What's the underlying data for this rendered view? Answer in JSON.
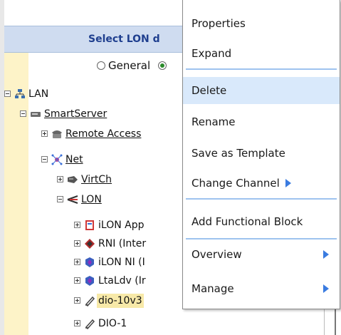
{
  "panel": {
    "header": "Select LON d",
    "radio_general": "General"
  },
  "tree": {
    "lan": "LAN",
    "smartserver": "SmartServer",
    "remote_access": "Remote Access",
    "net": "Net",
    "virtch": "VirtCh",
    "lon": "LON",
    "ilon_app": "iLON App",
    "rni": "RNI (Inter",
    "ilon_ni": "iLON NI (I",
    "ltaldv": "LtaLdv (Ir",
    "dio_10v3": "dio-10v3",
    "dio_1": "DIO-1"
  },
  "menu": {
    "properties": "Properties",
    "expand": "Expand",
    "delete": "Delete",
    "rename": "Rename",
    "save_as_template": "Save as Template",
    "change_channel": "Change Channel",
    "add_functional_block": "Add Functional Block",
    "overview": "Overview",
    "manage": "Manage"
  },
  "colors": {
    "menu_highlight": "#d9e9fb",
    "separator": "#9ec3ef",
    "submenu_arrow": "#3a7be0",
    "header_bg": "#cfdcf0",
    "header_text": "#1f3f8f"
  }
}
